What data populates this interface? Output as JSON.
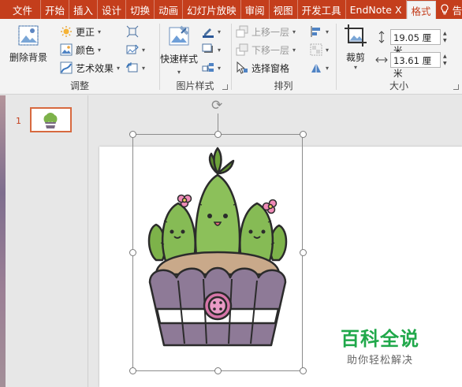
{
  "tabs": [
    "文件",
    "开始",
    "插入",
    "设计",
    "切换",
    "动画",
    "幻灯片放映",
    "审阅",
    "视图",
    "开发工具",
    "EndNote X",
    "格式",
    "告诉我"
  ],
  "active_tab": "格式",
  "ribbon": {
    "adjust": {
      "remove_bg": "删除背景",
      "corrections": "更正",
      "color": "颜色",
      "artistic": "艺术效果",
      "label": "调整"
    },
    "picture_styles": {
      "quick_styles": "快速样式",
      "label": "图片样式"
    },
    "arrange": {
      "bring_forward": "上移一层",
      "send_backward": "下移一层",
      "selection_pane": "选择窗格",
      "label": "排列"
    },
    "size": {
      "crop": "裁剪",
      "height": "19.05 厘米",
      "width": "13.61 厘米",
      "label": "大小"
    }
  },
  "slides": {
    "current_number": "1"
  },
  "watermark": {
    "title": "百科全说",
    "subtitle": "助你轻松解决"
  },
  "colors": {
    "accent": "#c43e1c",
    "ribbon_bg": "#f3f3f3",
    "watermark_green": "#20a84a"
  },
  "icons": [
    "remove-background-icon",
    "corrections-icon",
    "color-icon",
    "artistic-effects-icon",
    "compress-icon",
    "change-picture-icon",
    "reset-picture-icon",
    "quick-styles-icon",
    "border-icon",
    "effects-icon",
    "layout-icon",
    "bring-forward-icon",
    "send-backward-icon",
    "selection-pane-icon",
    "align-icon",
    "group-icon",
    "rotate-icon",
    "crop-icon",
    "height-icon",
    "width-icon",
    "rotate-handle-icon",
    "lightbulb-icon"
  ]
}
